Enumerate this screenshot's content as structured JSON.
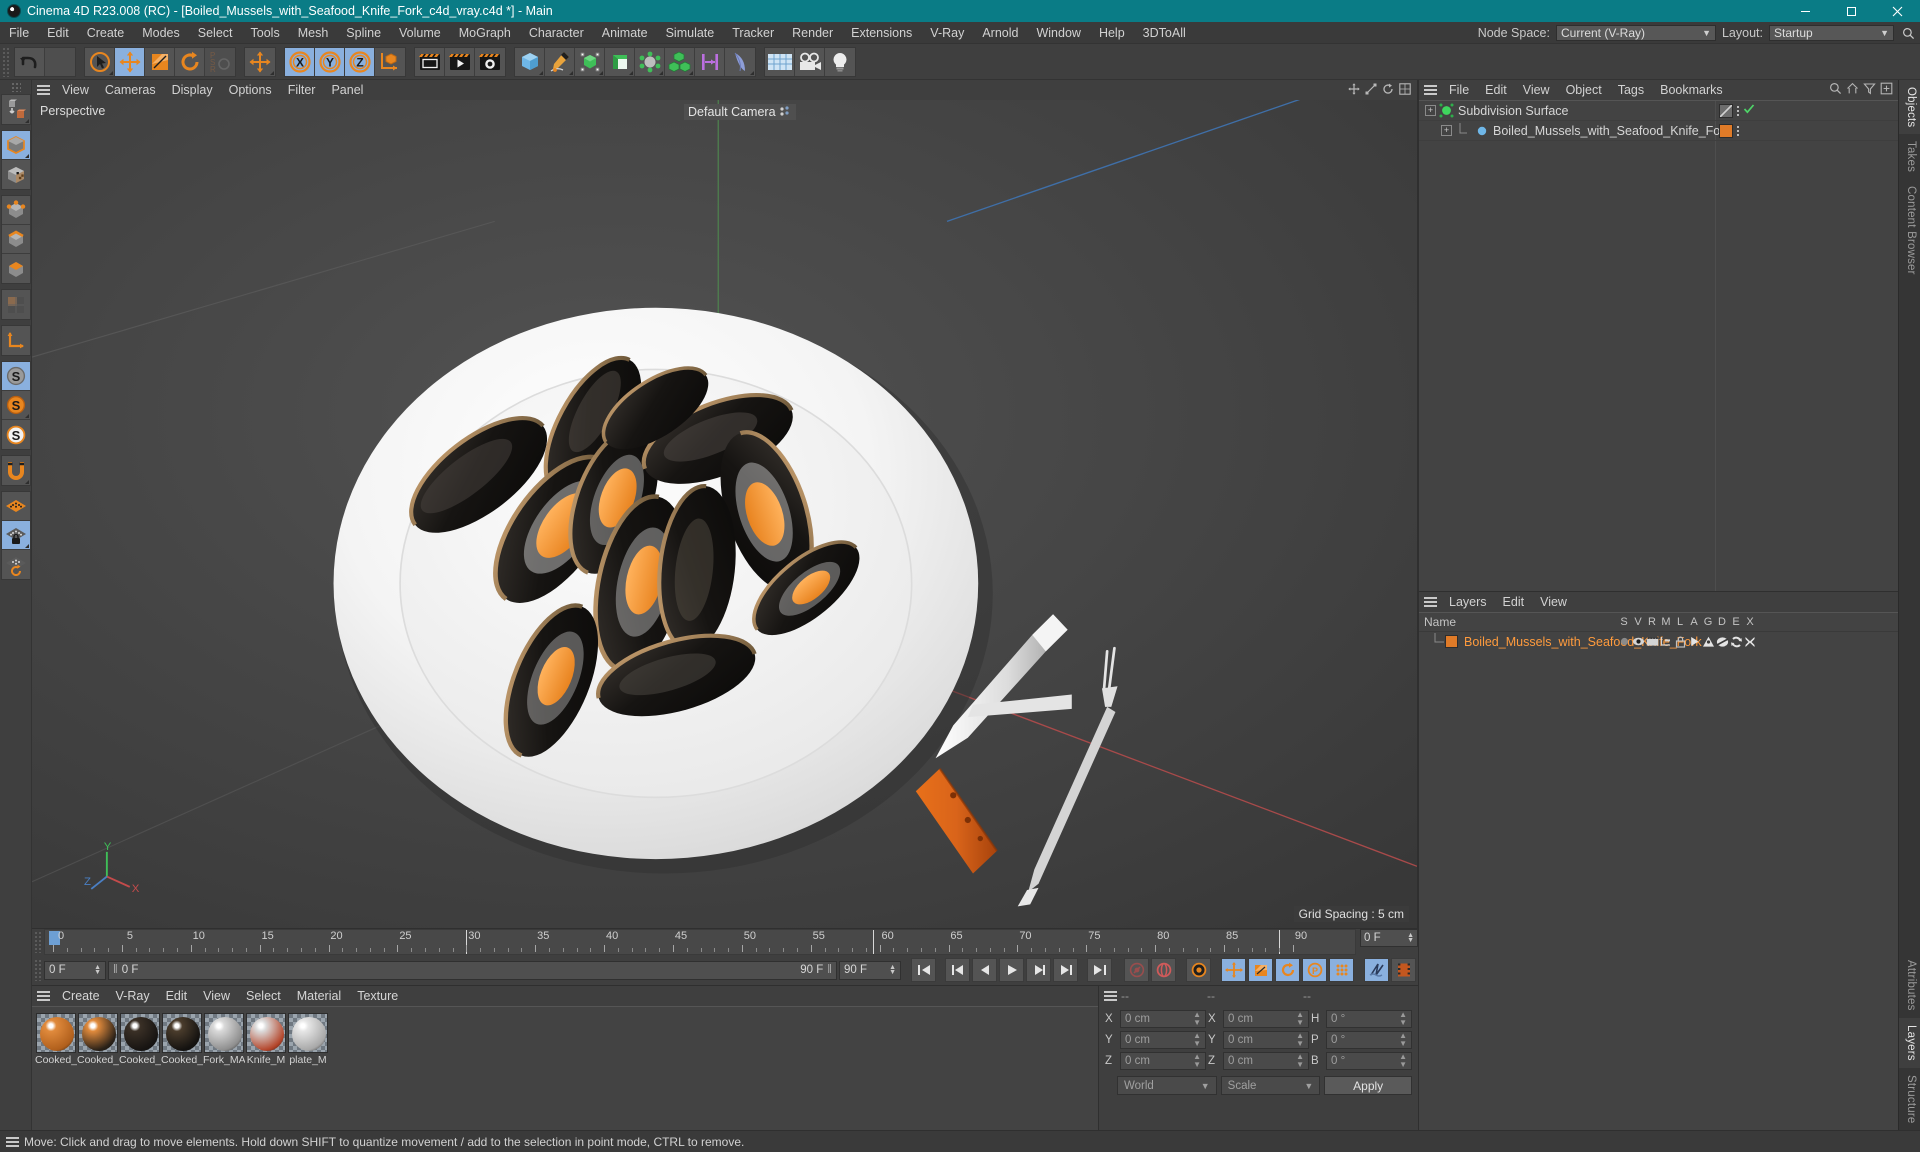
{
  "window": {
    "title": "Cinema 4D R23.008 (RC) - [Boiled_Mussels_with_Seafood_Knife_Fork_c4d_vray.c4d *] - Main",
    "accent": "#0a7c86",
    "minimize": "minimize-button",
    "maximize": "maximize-button",
    "close": "close-button"
  },
  "menubar": {
    "items": [
      "File",
      "Edit",
      "Create",
      "Modes",
      "Select",
      "Tools",
      "Mesh",
      "Spline",
      "Volume",
      "MoGraph",
      "Character",
      "Animate",
      "Simulate",
      "Tracker",
      "Render",
      "Extensions",
      "V-Ray",
      "Arnold",
      "Window",
      "Help",
      "3DToAll"
    ],
    "node_space_label": "Node Space:",
    "node_space_value": "Current (V-Ray)",
    "layout_label": "Layout:",
    "layout_value": "Startup"
  },
  "toolbar": {
    "undo": "Undo",
    "redo": "Redo",
    "live_selection": "Live Selection",
    "move": "Move",
    "scale": "Scale",
    "rotate": "Rotate",
    "psr": "PSR",
    "move_world": "Move (World)",
    "axis_x": "X",
    "axis_y": "Y",
    "axis_z": "Z",
    "coord_system": "World/Object Coordinate System",
    "render_view": "Render View",
    "render_to_picture_viewer": "Render to Picture Viewer",
    "render_settings": "Render Settings",
    "cube": "Cube / Primitives",
    "spline_pen": "Spline Pen",
    "subdivision": "Subdivision Surface / Generators",
    "extrude": "Extrude / NURBS",
    "deformer": "Deformers",
    "mograph": "MoGraph / Cloner",
    "scene_nodes": "Scene Nodes",
    "field": "Field",
    "floor": "Floor / Environment",
    "camera": "Camera",
    "light": "Light"
  },
  "lefttools": {
    "groups": [
      {
        "items": [
          {
            "name": "make-editable",
            "label": "Make Editable",
            "active": false
          }
        ]
      },
      {
        "items": [
          {
            "name": "model-mode",
            "label": "Model Mode",
            "active": true
          },
          {
            "name": "texture-mode",
            "label": "Texture Mode",
            "active": false
          }
        ]
      },
      {
        "items": [
          {
            "name": "points-mode",
            "label": "Points",
            "active": false
          },
          {
            "name": "edges-mode",
            "label": "Edges",
            "active": false
          },
          {
            "name": "polygons-mode",
            "label": "Polygons",
            "active": false
          }
        ]
      },
      {
        "items": [
          {
            "name": "enable-axis-modification",
            "label": "Enable Axis Modification",
            "active": false
          }
        ]
      },
      {
        "items": [
          {
            "name": "world-object-axis",
            "label": "World/Object Axis",
            "active": false
          }
        ]
      },
      {
        "items": [
          {
            "name": "viewport-solo-off",
            "label": "Viewport Solo Off",
            "active": true
          },
          {
            "name": "viewport-solo-single",
            "label": "Viewport Solo Single",
            "active": false
          },
          {
            "name": "viewport-solo-hierarchy",
            "label": "Viewport Solo Hierarchy",
            "active": false
          }
        ]
      },
      {
        "items": [
          {
            "name": "enable-snapping",
            "label": "Enable Snapping",
            "active": false
          }
        ]
      },
      {
        "items": [
          {
            "name": "workplane-xz",
            "label": "Workplane XZ",
            "active": false
          },
          {
            "name": "lock-workplane",
            "label": "Lock Workplane",
            "active": true
          },
          {
            "name": "workplane-mode",
            "label": "Workplane Mode",
            "active": false
          }
        ]
      }
    ]
  },
  "viewport": {
    "menu": [
      "View",
      "Cameras",
      "Display",
      "Options",
      "Filter",
      "Panel"
    ],
    "label": "Perspective",
    "camera_label": "Default Camera",
    "grid_spacing": "Grid Spacing : 5 cm",
    "axis_x": "X",
    "axis_y": "Y",
    "axis_z": "Z"
  },
  "timeline": {
    "start_frame": "0 F",
    "current_frame": "0 F",
    "end_frame": "90 F",
    "preview_end": "90 F",
    "frame_field": "0 F",
    "tick_labels": [
      "0",
      "5",
      "10",
      "15",
      "20",
      "25",
      "30",
      "35",
      "40",
      "45",
      "50",
      "55",
      "60",
      "65",
      "70",
      "75",
      "80",
      "85",
      "90"
    ],
    "transport": [
      "go-to-start",
      "go-to-previous-key",
      "go-to-previous-frame",
      "play",
      "go-to-next-frame",
      "go-to-next-key",
      "go-to-end"
    ],
    "record_buttons": [
      "record-active-objects",
      "autokeying",
      "keyframe-selection"
    ],
    "param_buttons": [
      "position",
      "scale",
      "rotation",
      "parameter",
      "point-level-animation"
    ],
    "extra_buttons": [
      "dynamics",
      "timeline-view"
    ]
  },
  "materials": {
    "menu": [
      "Create",
      "V-Ray",
      "Edit",
      "View",
      "Select",
      "Material",
      "Texture"
    ],
    "items": [
      {
        "name": "Cooked_",
        "color1": "#e08a3c",
        "color2": "#b05f1c",
        "type": "shell-cooked"
      },
      {
        "name": "Cooked_",
        "color1": "#e08a3c",
        "color2": "#2a2118",
        "type": "shell-cooked"
      },
      {
        "name": "Cooked_",
        "color1": "#3a3026",
        "color2": "#171412",
        "type": "shell-dark"
      },
      {
        "name": "Cooked_",
        "color1": "#4a3c2c",
        "color2": "#141210",
        "type": "shell-dark"
      },
      {
        "name": "Fork_MA",
        "color1": "#d9d9d9",
        "color2": "#8e8e8e",
        "type": "metal"
      },
      {
        "name": "Knife_M",
        "color1": "#dcdcdc",
        "color2": "#b4452a",
        "type": "metal-wood"
      },
      {
        "name": "plate_M",
        "color1": "#e6e6e6",
        "color2": "#a8a8a8",
        "type": "ceramic"
      }
    ]
  },
  "coordinates": {
    "title_left": "--",
    "title_mid": "--",
    "title_right": "--",
    "rows": [
      {
        "l1": "X",
        "v1": "0 cm",
        "l2": "X",
        "v2": "0 cm",
        "l3": "H",
        "v3": "0 °"
      },
      {
        "l1": "Y",
        "v1": "0 cm",
        "l2": "Y",
        "v2": "0 cm",
        "l3": "P",
        "v3": "0 °"
      },
      {
        "l1": "Z",
        "v1": "0 cm",
        "l2": "Z",
        "v2": "0 cm",
        "l3": "B",
        "v3": "0 °"
      }
    ],
    "system": "World",
    "mode": "Scale",
    "apply": "Apply"
  },
  "objects_panel": {
    "menu": [
      "File",
      "Edit",
      "View",
      "Object",
      "Tags",
      "Bookmarks"
    ],
    "rows": [
      {
        "name": "Subdivision Surface",
        "indent": 0,
        "selected": false,
        "icon": "subdivision-surface-icon",
        "tag_color": "#6d6d6d",
        "has_check": true
      },
      {
        "name": "Boiled_Mussels_with_Seafood_Knife_Fork",
        "indent": 1,
        "selected": false,
        "icon": "polygon-object-icon",
        "tag_color": "#e07b28",
        "has_check": false
      }
    ]
  },
  "layers_panel": {
    "menu": [
      "Layers",
      "Edit",
      "View"
    ],
    "name_header": "Name",
    "flags": [
      "S",
      "V",
      "R",
      "M",
      "L",
      "A",
      "G",
      "D",
      "E",
      "X"
    ],
    "rows": [
      {
        "name": "Boiled_Mussels_with_Seafood_Knife_Fork",
        "color": "#e07b28"
      }
    ]
  },
  "right_tabs_top": [
    "Objects",
    "Takes",
    "Content Browser"
  ],
  "right_tabs_bottom": [
    "Attributes",
    "Layers",
    "Structure"
  ],
  "statusbar": {
    "message": "Move: Click and drag to move elements. Hold down SHIFT to quantize movement / add to the selection in point mode, CTRL to remove."
  }
}
